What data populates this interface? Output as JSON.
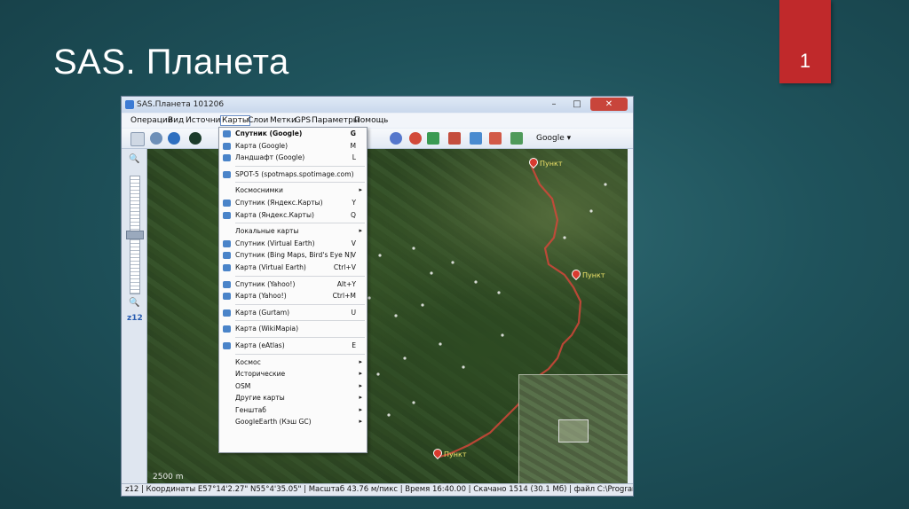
{
  "slide": {
    "title": "SAS. Планета",
    "page_number": "1"
  },
  "window": {
    "title": "SAS.Планета 101206",
    "controls": {
      "minimize": "–",
      "maximize": "□",
      "close": "✕"
    }
  },
  "menubar": [
    "Операции",
    "Вид",
    "Источник",
    "Карты",
    "Слои",
    "Метки",
    "GPS",
    "Параметры",
    "Помощь"
  ],
  "toolbar": {
    "map_source": "Google ▾"
  },
  "zoom": {
    "level": "z12"
  },
  "map": {
    "scale": "2500 m",
    "route_color": "#d2463a",
    "pin_labels": [
      "Пункт",
      "Пункт",
      "Пункт"
    ]
  },
  "statusbar": {
    "text": "z12 | Координаты E57°14'2.27\" N55°4'35.05\"   | Масштаб 43.76 м/пикс | Время 16:40.00 | Скачано 1514 (30.1 Мб) | файл C:\\Program Files (x8"
  },
  "dropdown": {
    "items": [
      {
        "label": "Спутник (Google)",
        "shortcut": "G",
        "icon": "globe-icon",
        "bold": true
      },
      {
        "label": "Карта (Google)",
        "shortcut": "M",
        "icon": "globe-icon"
      },
      {
        "label": "Ландшафт (Google)",
        "shortcut": "L",
        "icon": "globe-icon"
      },
      {
        "sep": true
      },
      {
        "label": "SPOT-5 (spotmaps.spotimage.com)",
        "shortcut": "",
        "icon": "globe-icon"
      },
      {
        "sep": true
      },
      {
        "label": "Космоснимки",
        "arrow": true
      },
      {
        "label": "Спутник (Яндекс.Карты)",
        "shortcut": "Y",
        "icon": "globe-icon"
      },
      {
        "label": "Карта (Яндекс.Карты)",
        "shortcut": "Q",
        "icon": "globe-icon"
      },
      {
        "sep": true
      },
      {
        "label": "Локальные карты",
        "arrow": true
      },
      {
        "label": "Спутник (Virtual Earth)",
        "shortcut": "V",
        "icon": "globe-icon"
      },
      {
        "label": "Спутник (Bing Maps, Bird's Eye N)",
        "shortcut": "V",
        "icon": "globe-icon"
      },
      {
        "label": "Карта (Virtual Earth)",
        "shortcut": "Ctrl+V",
        "icon": "globe-icon"
      },
      {
        "sep": true
      },
      {
        "label": "Спутник (Yahoo!)",
        "shortcut": "Alt+Y",
        "icon": "globe-icon"
      },
      {
        "label": "Карта (Yahoo!)",
        "shortcut": "Ctrl+M",
        "icon": "globe-icon"
      },
      {
        "sep": true
      },
      {
        "label": "Карта (Gurtam)",
        "shortcut": "U",
        "icon": "globe-icon"
      },
      {
        "sep": true
      },
      {
        "label": "Карта (WikiMapia)",
        "shortcut": "",
        "icon": "globe-icon"
      },
      {
        "sep": true
      },
      {
        "label": "Карта (eAtlas)",
        "shortcut": "E",
        "icon": "globe-icon"
      },
      {
        "sep": true
      },
      {
        "label": "Космос",
        "arrow": true
      },
      {
        "label": "Исторические",
        "arrow": true
      },
      {
        "label": "OSM",
        "arrow": true
      },
      {
        "label": "Другие карты",
        "arrow": true
      },
      {
        "label": "Генштаб",
        "arrow": true
      },
      {
        "label": "GoogleEarth (Кэш GC)",
        "arrow": true
      }
    ]
  }
}
